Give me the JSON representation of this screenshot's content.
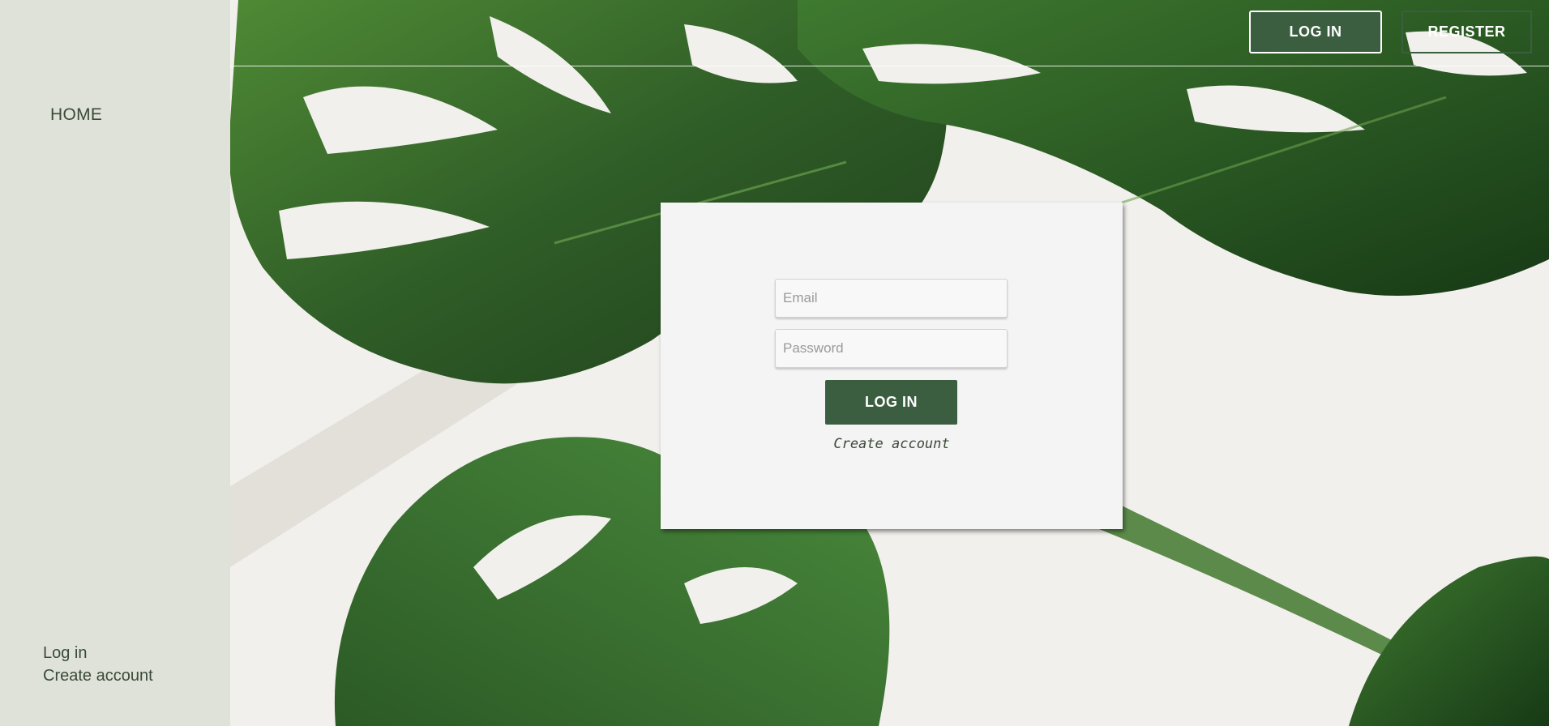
{
  "header": {
    "login_label": "LOG IN",
    "register_label": "REGISTER"
  },
  "sidebar": {
    "home_label": "HOME",
    "bottom_links": [
      "Log in",
      "Create account"
    ]
  },
  "login_form": {
    "email_placeholder": "Email",
    "password_placeholder": "Password",
    "submit_label": "LOG IN",
    "create_account_label": "Create account"
  },
  "colors": {
    "accent_green": "#3b5e40",
    "sidebar_bg": "#dfe2d9",
    "card_bg": "#f4f4f4",
    "text_dark": "#3b4a38"
  },
  "background_image": "monstera-leaves"
}
